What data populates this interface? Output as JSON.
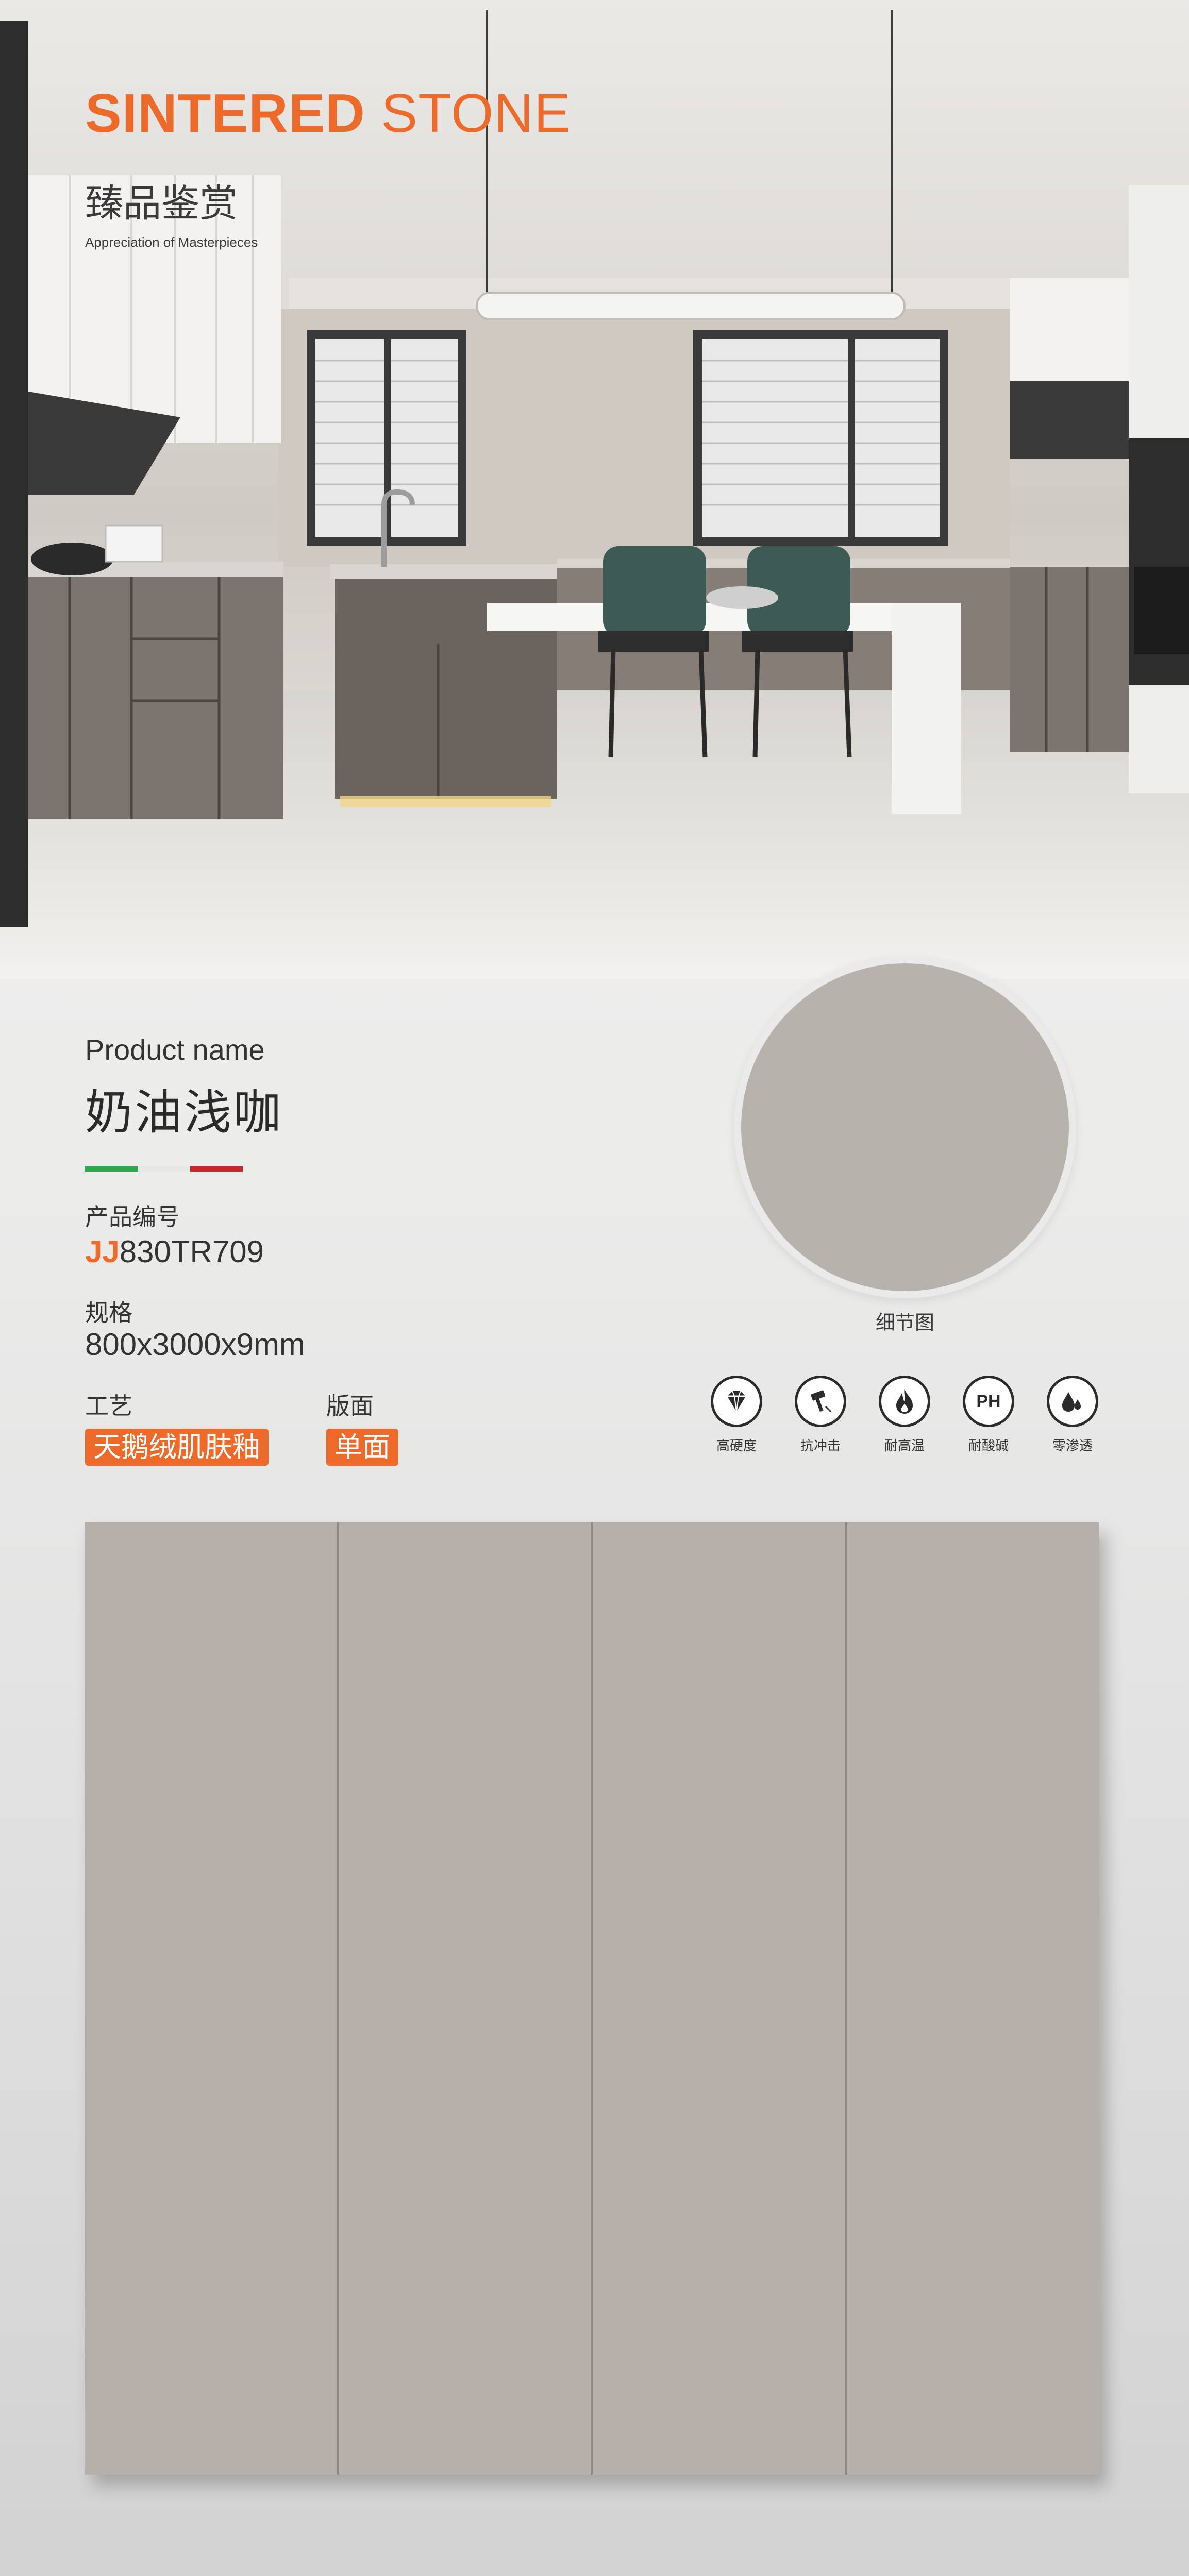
{
  "brand": {
    "title_bold": "SINTERED",
    "title_light": "STONE",
    "subtitle_cn": "臻品鉴赏",
    "subtitle_en": "Appreciation of Masterpieces"
  },
  "product": {
    "name_label": "Product name",
    "name": "奶油浅咖",
    "code_label": "产品编号",
    "code_prefix": "JJ",
    "code_number": "830TR709",
    "spec_label": "规格",
    "spec_value": "800x3000x9mm",
    "craft_label": "工艺",
    "craft_value": "天鹅绒肌肤釉",
    "surface_label": "版面",
    "surface_value": "单面"
  },
  "swatch": {
    "caption": "细节图",
    "color": "#b8b2ac"
  },
  "features": [
    {
      "icon": "diamond-icon",
      "label": "高硬度"
    },
    {
      "icon": "hammer-icon",
      "label": "抗冲击"
    },
    {
      "icon": "flame-icon",
      "label": "耐高温"
    },
    {
      "icon": "ph-icon",
      "label": "耐酸碱",
      "icon_text": "PH"
    },
    {
      "icon": "droplet-icon",
      "label": "零渗透"
    }
  ],
  "colors": {
    "accent": "#ee6a2a",
    "flag_green": "#2aa84a",
    "flag_white": "#e6e6e6",
    "flag_red": "#c8252c",
    "panel": "#b7b0aa"
  },
  "panels": {
    "count": 4
  }
}
